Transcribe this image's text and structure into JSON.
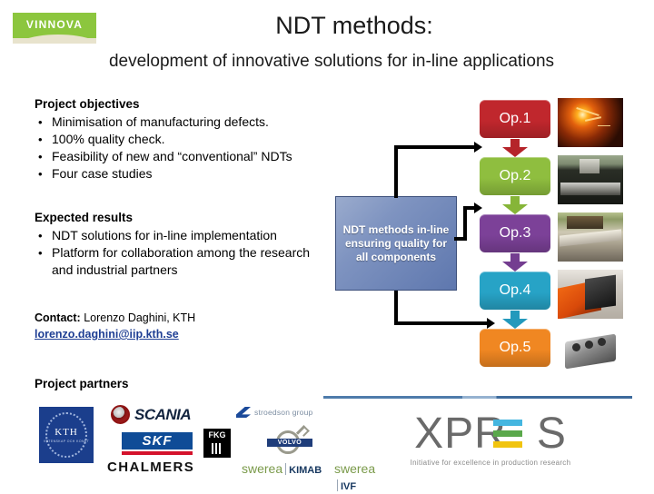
{
  "header": {
    "logo_name": "VINNOVA",
    "title": "NDT methods:",
    "subtitle": "development of innovative solutions for in-line applications"
  },
  "objectives": {
    "heading": "Project objectives",
    "bullet_char": "•",
    "items": [
      "Minimisation of manufacturing defects.",
      "100% quality check.",
      "Feasibility of new and “conventional” NDTs",
      "Four case studies"
    ]
  },
  "results": {
    "heading": "Expected results",
    "bullet_char": "•",
    "items": [
      "NDT solutions for in-line implementation",
      "Platform for collaboration among the research and industrial partners"
    ]
  },
  "contact": {
    "label": "Contact:",
    "person": "Lorenzo Daghini, KTH",
    "email": "lorenzo.daghini@iip.kth.se"
  },
  "center_box": {
    "text": "NDT methods in-line ensuring quality for all components",
    "fill_top": "#9aabcd",
    "fill_bottom": "#5e77ae",
    "border": "#3c4f7a"
  },
  "operations": [
    {
      "label": "Op.1",
      "color": "#c0272d",
      "arrow_color": "#b5242a"
    },
    {
      "label": "Op.2",
      "color": "#8fbe3f",
      "arrow_color": "#86b538"
    },
    {
      "label": "Op.3",
      "color": "#7c4198",
      "arrow_color": "#743d90"
    },
    {
      "label": "Op.4",
      "color": "#27a3c6",
      "arrow_color": "#2399bc"
    },
    {
      "label": "Op.5",
      "color": "#f08722",
      "arrow_color": "#e07d1d"
    }
  ],
  "thumbnails": [
    {
      "name": "foundry-casting-photo"
    },
    {
      "name": "machining-dark-photo"
    },
    {
      "name": "machine-bed-photo"
    },
    {
      "name": "engine-block-orange-photo"
    },
    {
      "name": "engine-block-grey-photo"
    }
  ],
  "partners": {
    "heading": "Project partners",
    "logos": [
      {
        "name": "kth",
        "text": "KTH",
        "sub": "VETENSKAP OCH KONST"
      },
      {
        "name": "scania",
        "text": "SCANIA"
      },
      {
        "name": "stroedson-group",
        "text": "stroedson group"
      },
      {
        "name": "skf",
        "text": "SKF"
      },
      {
        "name": "fkg",
        "text": "FKG"
      },
      {
        "name": "volvo",
        "text": "VOLVO"
      },
      {
        "name": "chalmers",
        "text": "CHALMERS"
      },
      {
        "name": "swerea-kimab",
        "text": "swerea",
        "sub": "KIMAB"
      },
      {
        "name": "swerea-ivf",
        "text": "swerea",
        "sub": "IVF"
      }
    ]
  },
  "xpres": {
    "word_left": "XPR",
    "word_right": "S",
    "tagline": "Initiative for excellence in production research",
    "bar_colors": [
      "#45b6e0",
      "#5aa84b",
      "#f1c40f"
    ],
    "text_color": "#6a6a6a"
  }
}
